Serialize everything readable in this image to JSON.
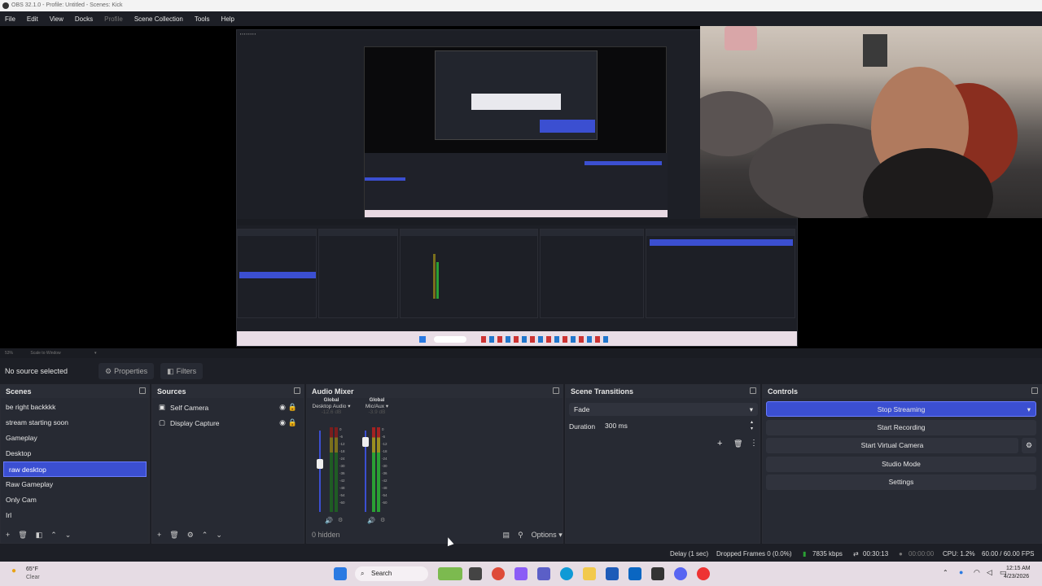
{
  "window": {
    "title": "OBS 32.1.0 - Profile: Untitled - Scenes: Kick"
  },
  "menu": [
    "File",
    "Edit",
    "View",
    "Docks",
    "Profile",
    "Scene Collection",
    "Tools",
    "Help"
  ],
  "preview": {
    "zoom_text": "53%",
    "scale_label": "Scale to Window"
  },
  "sourcebar": {
    "no_source": "No source selected",
    "properties": "Properties",
    "filters": "Filters"
  },
  "scenes": {
    "title": "Scenes",
    "items": [
      "be right backkkk",
      "stream starting soon",
      "Gameplay",
      "Desktop",
      "raw desktop",
      "Raw Gameplay",
      "Only Cam",
      "Irl"
    ],
    "selected_index": 4
  },
  "sources": {
    "title": "Sources",
    "items": [
      {
        "label": "Self Camera",
        "icon": "camera-icon"
      },
      {
        "label": "Display Capture",
        "icon": "monitor-icon"
      }
    ]
  },
  "mixer": {
    "title": "Audio Mixer",
    "channels": [
      {
        "scope": "Global",
        "name": "Desktop Audio",
        "db": "-12.6 dB"
      },
      {
        "scope": "Global",
        "name": "Mic/Aux",
        "db": "-3.9 dB"
      }
    ],
    "hidden": "0 hidden",
    "options": "Options",
    "ticks": [
      "0",
      "-6",
      "-12",
      "-18",
      "-24",
      "-30",
      "-36",
      "-42",
      "-48",
      "-54",
      "-60"
    ]
  },
  "transitions": {
    "title": "Scene Transitions",
    "selected": "Fade",
    "duration_label": "Duration",
    "duration_value": "300 ms"
  },
  "controls": {
    "title": "Controls",
    "stop_streaming": "Stop Streaming",
    "start_recording": "Start Recording",
    "start_virtual_camera": "Start Virtual Camera",
    "studio_mode": "Studio Mode",
    "settings": "Settings"
  },
  "status": {
    "delay": "Delay (1 sec)",
    "dropped": "Dropped Frames 0 (0.0%)",
    "kbps": "7835 kbps",
    "stream_time": "00:30:13",
    "rec_time": "00:00:00",
    "cpu": "CPU: 1.2%",
    "fps": "60.00 / 60.00 FPS"
  },
  "taskbar": {
    "weather_temp": "65°F",
    "weather_desc": "Clear",
    "search": "Search",
    "time": "12:15 AM",
    "date": "4/23/2026"
  },
  "colors": {
    "accent": "#3b4fd1",
    "panel": "#272a33",
    "bg": "#1d1f26"
  }
}
